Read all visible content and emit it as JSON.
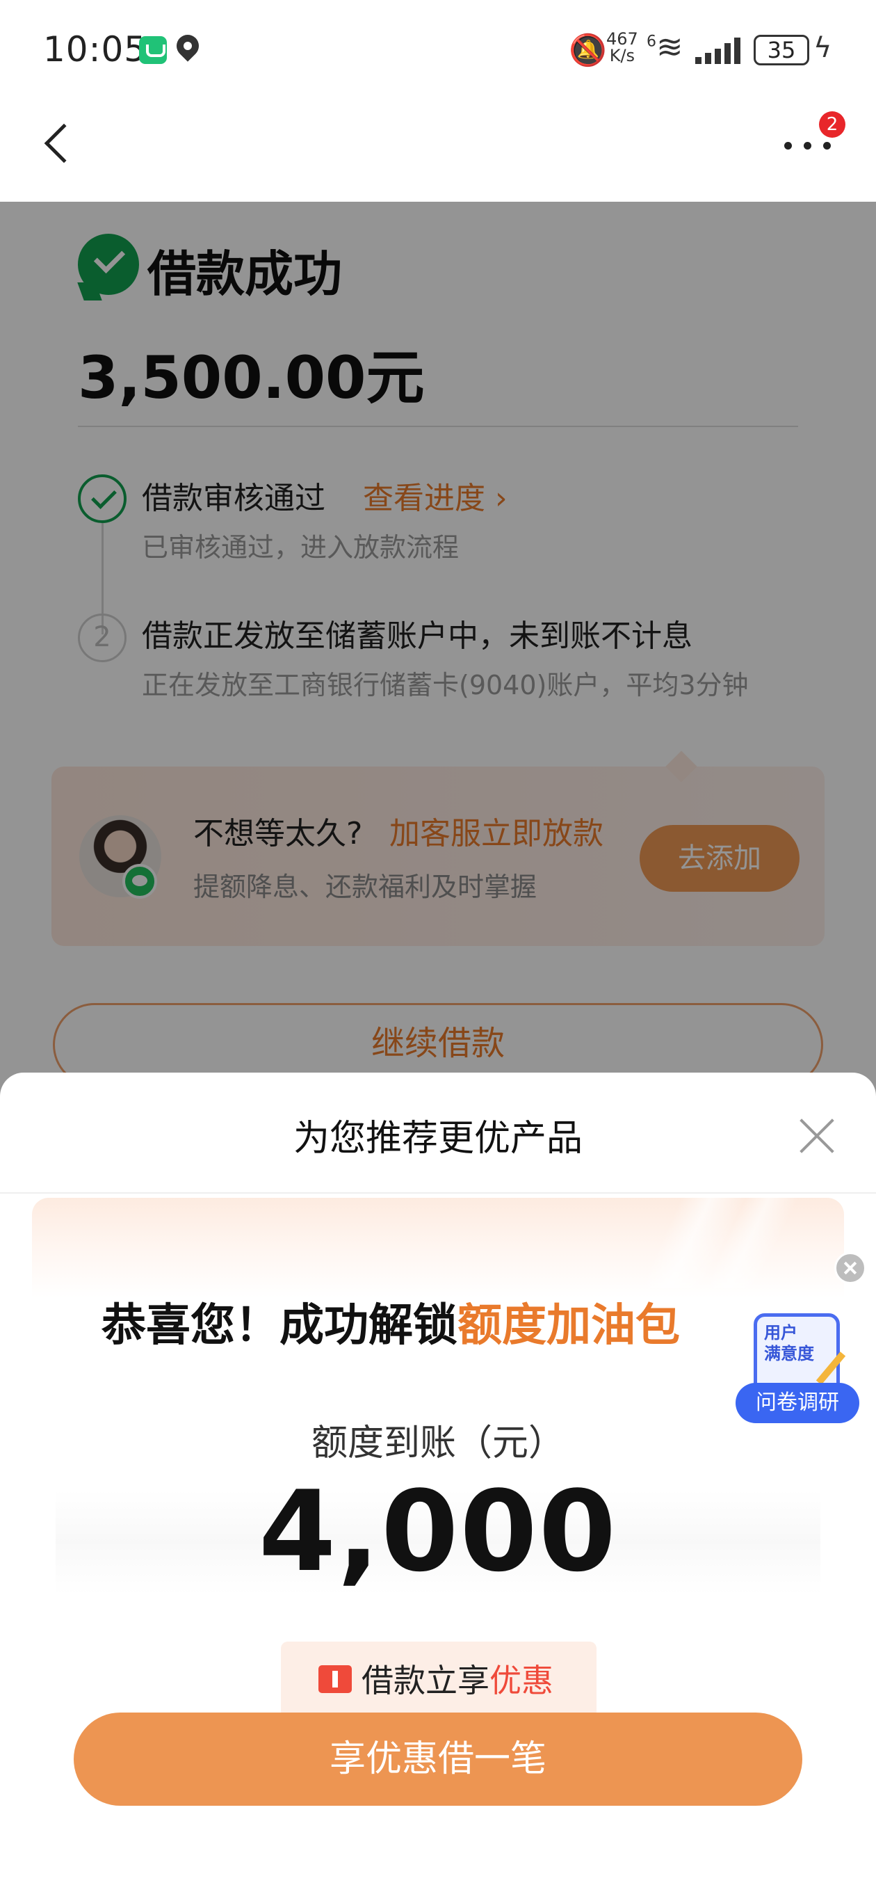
{
  "status_bar": {
    "time": "10:05",
    "net_speed_value": "467",
    "net_speed_unit": "K/s",
    "wifi_tag": "6",
    "battery": "35"
  },
  "nav": {
    "badge_count": "2"
  },
  "result": {
    "title": "借款成功",
    "amount": "3,500.00元"
  },
  "steps": [
    {
      "title": "借款审核通过",
      "link": "查看进度 ›",
      "subtitle": "已审核通过，进入放款流程"
    },
    {
      "number": "2",
      "title": "借款正发放至储蓄账户中，未到账不计息",
      "subtitle": "正在发放至工商银行储蓄卡(9040)账户，平均3分钟"
    }
  ],
  "service_card": {
    "title": "不想等太久?",
    "title_accent": "加客服立即放款",
    "subtitle": "提额降息、还款福利及时掌握",
    "button": "去添加"
  },
  "continue_button": "继续借款",
  "sheet": {
    "title": "为您推荐更优产品",
    "headline": "恭喜您！成功解锁",
    "headline_accent": "额度加油包",
    "quota_label": "额度到账（元）",
    "quota_value": "4,000",
    "coupon_text": "借款立享",
    "coupon_accent": "优惠",
    "cta": "享优惠借一笔"
  },
  "survey": {
    "phone_text": "用户\n满意度",
    "button": "问卷调研"
  },
  "colors": {
    "accent_orange": "#e97a2c",
    "success_green": "#12a150",
    "survey_blue": "#3a66f2",
    "coupon_red": "#ef4a3a"
  }
}
